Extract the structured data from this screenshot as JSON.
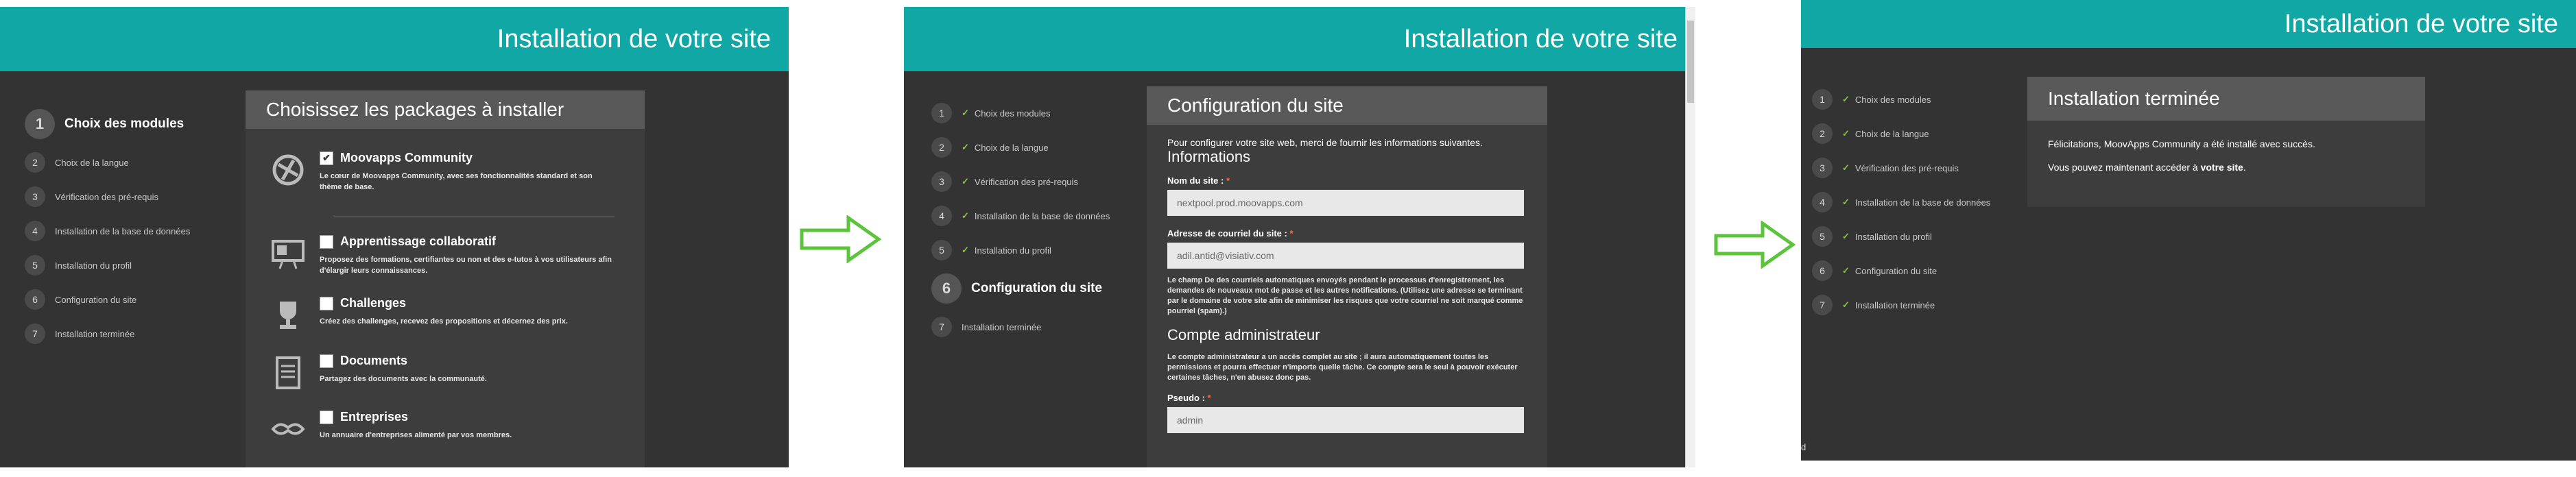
{
  "header_title": "Installation de votre site",
  "steps": [
    "Choix des modules",
    "Choix de la langue",
    "Vérification des pré-requis",
    "Installation de la base de données",
    "Installation du profil",
    "Configuration du site",
    "Installation terminée"
  ],
  "numbers": [
    "1",
    "2",
    "3",
    "4",
    "5",
    "6",
    "7"
  ],
  "panel1": {
    "card_title": "Choisissez les packages à installer",
    "packages": [
      {
        "name": "Moovapps Community",
        "checked": true,
        "desc": "Le cœur de Moovapps Community, avec ses fonctionnalités standard et son thème de base."
      },
      {
        "name": "Apprentissage collaboratif",
        "checked": false,
        "desc": "Proposez des formations, certifiantes ou non et des e-tutos à vos utilisateurs afin d'élargir leurs connaissances."
      },
      {
        "name": "Challenges",
        "checked": false,
        "desc": "Créez des challenges, recevez des propositions et décernez des prix."
      },
      {
        "name": "Documents",
        "checked": false,
        "desc": "Partagez des documents avec la communauté."
      },
      {
        "name": "Entreprises",
        "checked": false,
        "desc": "Un annuaire d'entreprises alimenté par vos membres."
      }
    ]
  },
  "panel2": {
    "card_title": "Configuration du site",
    "intro": "Pour configurer votre site web, merci de fournir les informations suivantes.",
    "section_info": "Informations",
    "site_name_label": "Nom du site :",
    "site_name_value": "nextpool.prod.moovapps.com",
    "email_label": "Adresse de courriel du site :",
    "email_value": "adil.antid@visiativ.com",
    "email_help": "Le champ De des courriels automatiques envoyés pendant le processus d'enregistrement, les demandes de nouveaux mot de passe et les autres notifications. (Utilisez une adresse se terminant par le domaine de votre site afin de minimiser les risques que votre courriel ne soit marqué comme pourriel (spam).)",
    "section_admin": "Compte administrateur",
    "admin_help": "Le compte administrateur a un accès complet au site ; il aura automatiquement toutes les permissions et pourra effectuer n'importe quelle tâche. Ce compte sera le seul à pouvoir exécuter certaines tâches, n'en abusez donc pas.",
    "pseudo_label": "Pseudo :",
    "pseudo_value": "admin",
    "required_mark": "*"
  },
  "panel3": {
    "card_title": "Installation terminée",
    "line1": "Félicitations, MoovApps Community a été installé avec succès.",
    "line2_prefix": "Vous pouvez maintenant accéder à ",
    "line2_link": "votre site",
    "line2_suffix": ".",
    "corner": "d"
  },
  "colors": {
    "header": "#10a7a5",
    "panel": "#333333",
    "card": "#3d3d3d",
    "check": "#8bc34a",
    "arrow": "#5cc43c"
  }
}
